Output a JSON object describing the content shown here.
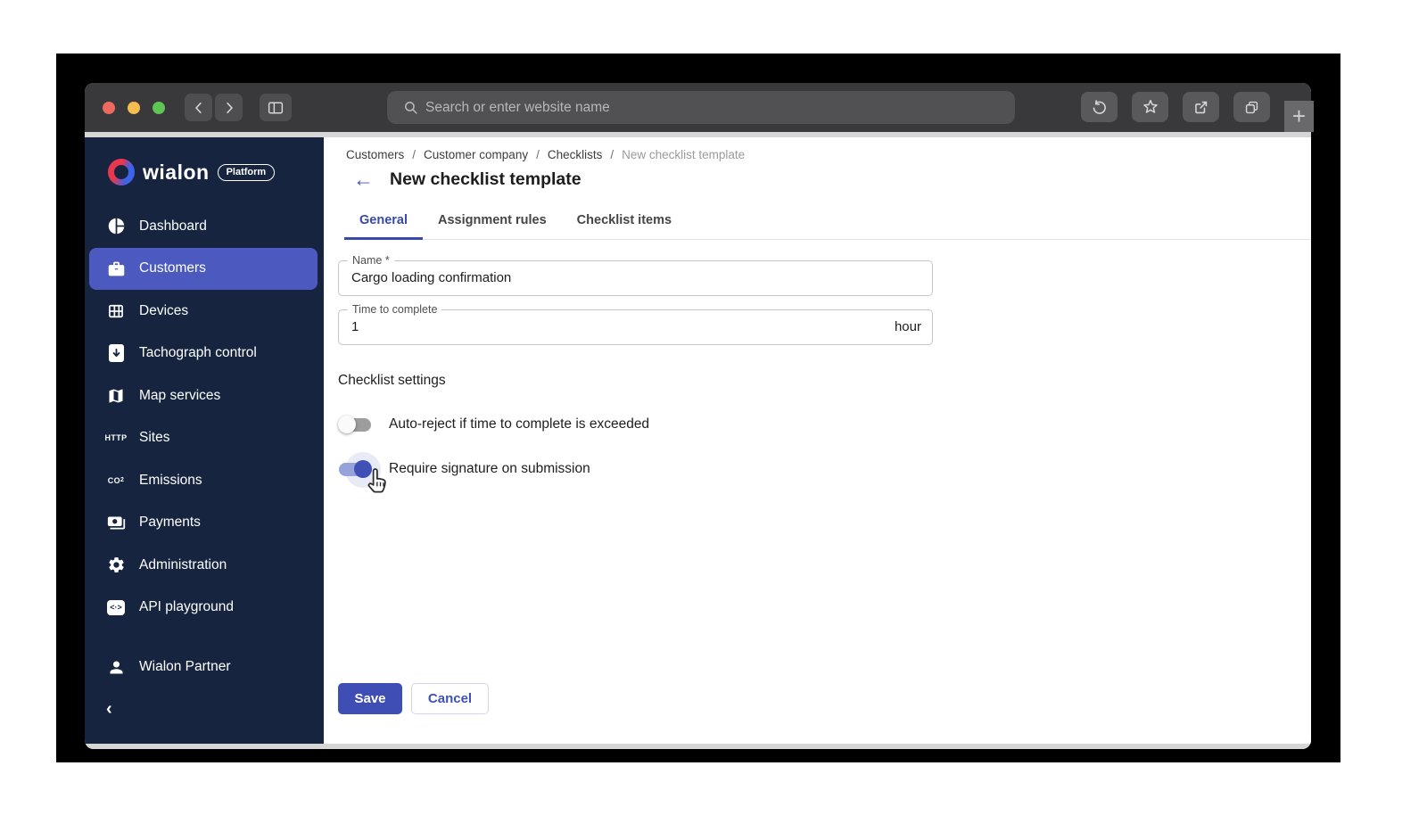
{
  "browser": {
    "search_placeholder": "Search or enter website name",
    "new_tab_label": "+"
  },
  "sidebar": {
    "logo_text": "wialon",
    "logo_badge": "Platform",
    "items": [
      {
        "label": "Dashboard"
      },
      {
        "label": "Customers",
        "selected": true
      },
      {
        "label": "Devices"
      },
      {
        "label": "Tachograph control"
      },
      {
        "label": "Map services"
      },
      {
        "label": "Sites",
        "icon_text": "HTTP"
      },
      {
        "label": "Emissions",
        "icon_text": "CO"
      },
      {
        "label": "Payments"
      },
      {
        "label": "Administration"
      },
      {
        "label": "API playground",
        "icon_text": "<·>"
      }
    ],
    "user_label": "Wialon Partner",
    "collapse_icon": "‹"
  },
  "main": {
    "breadcrumb": [
      "Customers",
      "Customer company",
      "Checklists",
      "New checklist template"
    ],
    "breadcrumb_separator": "/",
    "back_icon": "←",
    "title": "New checklist template",
    "tabs": [
      {
        "label": "General",
        "active": true
      },
      {
        "label": "Assignment rules",
        "active": false
      },
      {
        "label": "Checklist items",
        "active": false
      }
    ],
    "form": {
      "name_label": "Name *",
      "name_value": "Cargo loading confirmation",
      "time_label": "Time to complete",
      "time_value": "1",
      "time_unit": "hour"
    },
    "settings": {
      "heading": "Checklist settings",
      "toggles": [
        {
          "label": "Auto-reject if time to complete is exceeded",
          "on": false
        },
        {
          "label": "Require signature on submission",
          "on": true
        }
      ]
    },
    "buttons": {
      "save": "Save",
      "cancel": "Cancel"
    }
  },
  "colors": {
    "sidebar_bg": "#162440",
    "selected_item": "#4c5ac0",
    "accent_indigo": "#3f51b5",
    "chrome_bg": "#39393b",
    "toggle_on_track": "#97a1da",
    "toggle_off_track": "#9d9d9d"
  }
}
